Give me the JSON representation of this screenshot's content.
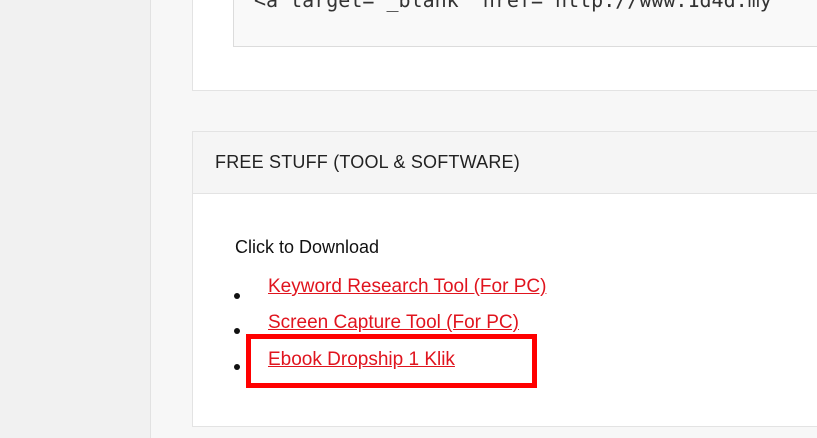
{
  "code_snippet": "<a target=\"_blank\" href=\"http://www.1d4d.my",
  "widget": {
    "title": "FREE STUFF (TOOL & SOFTWARE)",
    "intro": "Click to Download",
    "links": [
      {
        "label": "Keyword Research Tool (For PC)"
      },
      {
        "label": "Screen Capture Tool (For PC)"
      },
      {
        "label": "Ebook Dropship 1 Klik"
      }
    ]
  },
  "colors": {
    "link": "#e0141e",
    "highlight": "#ff0000"
  }
}
